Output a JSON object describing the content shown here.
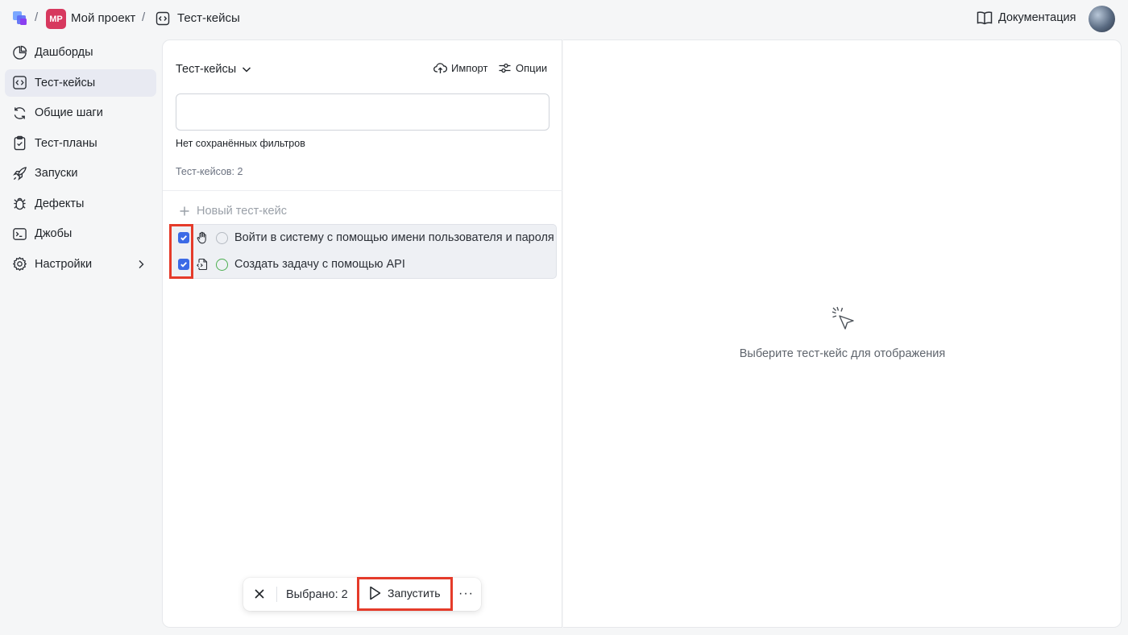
{
  "breadcrumb": {
    "project_badge": "MP",
    "project_name": "Мой проект",
    "section_name": "Тест-кейсы",
    "separator": "/"
  },
  "header": {
    "docs_label": "Документация"
  },
  "sidebar": {
    "items": [
      {
        "label": "Дашборды",
        "icon": "pie-chart-icon"
      },
      {
        "label": "Тест-кейсы",
        "icon": "code-brackets-icon",
        "active": true
      },
      {
        "label": "Общие шаги",
        "icon": "refresh-icon"
      },
      {
        "label": "Тест-планы",
        "icon": "clipboard-icon"
      },
      {
        "label": "Запуски",
        "icon": "rocket-icon"
      },
      {
        "label": "Дефекты",
        "icon": "bug-icon"
      },
      {
        "label": "Джобы",
        "icon": "terminal-icon"
      },
      {
        "label": "Настройки",
        "icon": "gear-icon",
        "has_submenu": true
      }
    ]
  },
  "testcases": {
    "title": "Тест-кейсы",
    "import_label": "Импорт",
    "options_label": "Опции",
    "search_value": "",
    "no_filters": "Нет сохранённых фильтров",
    "count_label": "Тест-кейсов: 2",
    "new_case_label": "Новый тест-кейс",
    "rows": [
      {
        "title": "Войти в систему с помощью имени пользователя и пароля",
        "checked": true,
        "type_icon": "hand-icon",
        "status": "gray"
      },
      {
        "title": "Создать задачу с помощью API",
        "checked": true,
        "type_icon": "file-code-icon",
        "status": "green"
      }
    ]
  },
  "empty_state": {
    "text": "Выберите тест-кейс для отображения",
    "icon": "cursor-click-icon"
  },
  "action_bar": {
    "selected_label": "Выбрано: 2",
    "run_label": "Запустить",
    "more_label": "···"
  },
  "colors": {
    "accent": "#3b6ae6",
    "highlight": "#e53b2a",
    "project_badge": "#d7385e",
    "status_green": "#4caf50"
  }
}
